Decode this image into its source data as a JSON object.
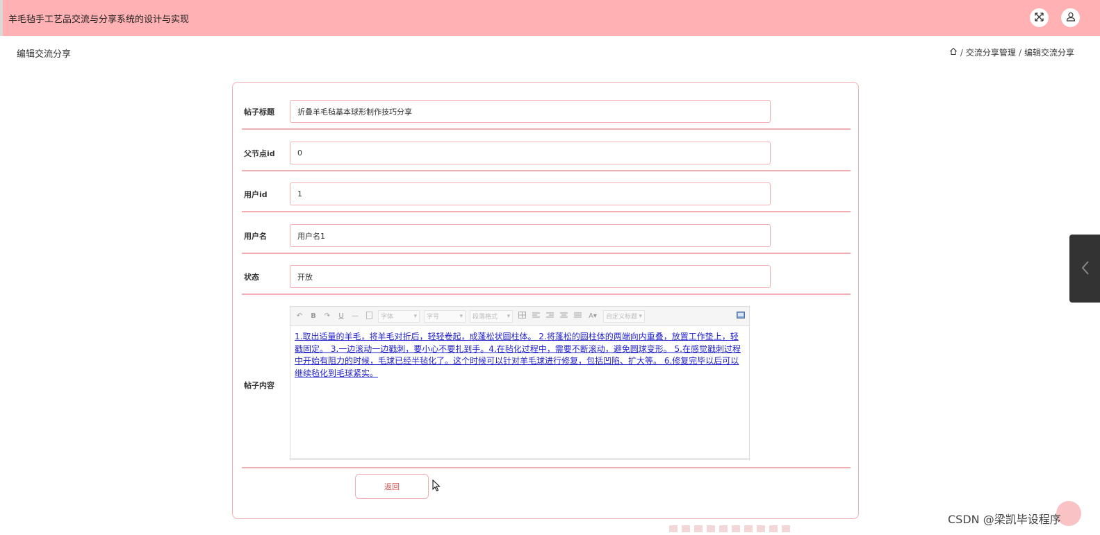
{
  "header": {
    "app_title": "羊毛毡手工艺品交流与分享系统的设计与实现",
    "fullscreen_icon": "fullscreen-icon",
    "user_icon": "user-icon"
  },
  "page": {
    "title": "编辑交流分享",
    "breadcrumb": {
      "home_icon": "home-icon",
      "items": [
        "交流分享管理",
        "编辑交流分享"
      ],
      "separator": "/"
    }
  },
  "form": {
    "fields": [
      {
        "label": "帖子标题",
        "value": "折叠羊毛毡基本球形制作技巧分享"
      },
      {
        "label": "父节点id",
        "value": "0"
      },
      {
        "label": "用户id",
        "value": "1"
      },
      {
        "label": "用户名",
        "value": "用户名1"
      },
      {
        "label": "状态",
        "value": "开放"
      }
    ],
    "content_label": "帖子内容",
    "editor": {
      "toolbar": {
        "undo": "↶",
        "bold": "B",
        "redo": "↷",
        "underline": "U",
        "hr": "—",
        "font_family": "字体",
        "font_size": "字号",
        "paragraph": "段落格式",
        "font_color": "A",
        "custom_title": "自定义标题"
      },
      "content": "1.取出适量的羊毛，将羊毛对折后，轻轻卷起，成蓬松状圆柱体。 2.将蓬松的圆柱体的两端向内重叠，放置工作垫上，轻戳固定。 3.一边滚动一边戳刺，要小心不要扎到手。4.在毡化过程中，需要不断滚动，避免圆球变形。 5.在感觉戳刺过程中开始有阻力的时候，毛球已经半毡化了。这个时候可以针对羊毛球进行修复，包括凹陷、扩大等。 6.修复完毕以后可以继续毡化到毛球紧实。"
    },
    "back_button": "返回"
  },
  "watermark": "CSDN @梁凯毕设程序",
  "colors": {
    "topbar": "#ffb1b4",
    "border": "#f2aeb2",
    "link": "#2222cc",
    "button_text": "#d9534f"
  }
}
